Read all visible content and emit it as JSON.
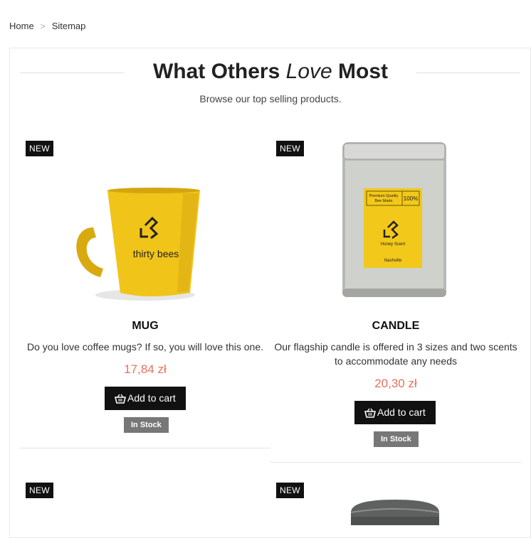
{
  "breadcrumb": {
    "home": "Home",
    "separator": ">",
    "current": "Sitemap"
  },
  "section": {
    "title_pre": "What Others",
    "title_em": "Love",
    "title_post": "Most",
    "subtitle": "Browse our top selling products."
  },
  "products": [
    {
      "badge": "NEW",
      "name": "MUG",
      "description": "Do you love coffee mugs? If so, you will love this one.",
      "price": "17,84 zł",
      "add_to_cart": "Add to cart",
      "stock": "In Stock",
      "image_brand": "thirty bees",
      "image_color": "#f0c419"
    },
    {
      "badge": "NEW",
      "name": "CANDLE",
      "description": "Our flagship candle is offered in 3 sizes and two scents to accommodate any needs",
      "price": "20,30 zł",
      "add_to_cart": "Add to cart",
      "stock": "In Stock",
      "label_top": "Premium Quality Bee Made",
      "label_pct": "100%",
      "label_scent": "Honey Scent",
      "label_city": "Nashville"
    },
    {
      "badge": "NEW"
    },
    {
      "badge": "NEW"
    }
  ],
  "colors": {
    "price": "#e8705c",
    "button": "#111111",
    "stock": "#777777",
    "mug": "#f0c419",
    "candle_label": "#f2c81a"
  }
}
